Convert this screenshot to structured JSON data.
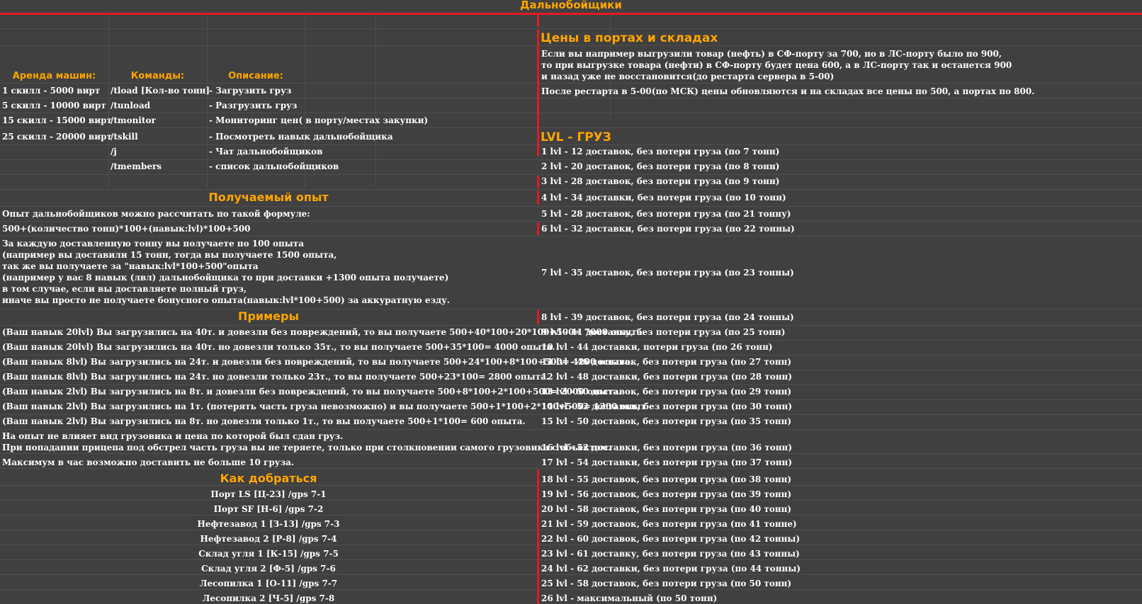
{
  "title": "Дальнобойщики",
  "left": {
    "rent_header": "Аренда машин:",
    "commands_header": "Команды:",
    "description_header": "Описание:",
    "rows": [
      {
        "rent": "1 скилл - 5000 вирт",
        "cmd": "/tload [Кол-во тонн]",
        "desc": "- Загрузить груз"
      },
      {
        "rent": "5 скилл - 10000 вирт",
        "cmd": "/tunload",
        "desc": "- Разгрузить груз"
      },
      {
        "rent": "15 скилл - 15000 вирт",
        "cmd": "/tmonitor",
        "desc": "- Мониторинг цен( в порту/местах закупки)"
      },
      {
        "rent": "25 скилл - 20000 вирт",
        "cmd": "/tskill",
        "desc": "- Посмотреть навык дальнобойщика"
      },
      {
        "rent": "",
        "cmd": "/j",
        "desc": "- Чат дальнобойщиков"
      },
      {
        "rent": "",
        "cmd": "/tmembers",
        "desc": "- список дальнобойщиков"
      }
    ],
    "exp_header": "Получаемый опыт",
    "exp_formula_intro": "Опыт дальнобойщиков можно рассчитать по такой формуле:",
    "exp_formula": "500+(количество тонн)*100+(навык:lvl)*100+500",
    "exp_explanation": [
      "За каждую доставленную тонну вы получаете по 100 опыта",
      "(например вы доставили 15 тонн, тогда вы получаете 1500 опыта,",
      "так же вы получаете за \"навык:lvl*100+500\"опыта",
      "(например у вас 8 навык (лвл) дальнобойщика то при доставки +1300 опыта получаете)",
      "в том случае, если вы доставляете полный груз,",
      "иначе вы просто не получаете бонусного опыта(навык:lvl*100+500) за аккуратную езду."
    ],
    "examples_header": "Примеры",
    "examples": [
      "(Ваш навык 20lvl) Вы загрузились на 40т. и довезли без повреждений, то вы получаете 500+40*100+20*100+500= 7000 опыта.",
      "(Ваш навык 20lvl) Вы загрузились на 40т. но довезли только 35т., то вы получаете 500+35*100= 4000 опыта.",
      "(Ваш навык 8lvl) Вы загрузились на 24т. и довезли без повреждений, то вы получаете 500+24*100+8*100+500= 4200 опыта.",
      "(Ваш навык 8lvl) Вы загрузились на 24т. но довезли только 23т., то вы получаете 500+23*100= 2800 опыта.",
      "(Ваш навык 2lvl) Вы загрузились на 8т. и довезли без повреждений, то вы получаете 500+8*100+2*100+500= 2000 опыта.",
      "(Ваш навык 2lvl) Вы загрузились на 1т. (потерять часть груза невозможно) и вы получаете 500+1*100+2*100+500= 1300 опыт",
      "(Ваш навык 2lvl) Вы загрузились на 8т. но довезли только 1т., то вы получаете 500+1*100= 600 опыта."
    ],
    "notes": [
      "На опыт не влияет вид грузовика и цена по которой был сдан груз.",
      "При попадании прицепа под обстрел часть груза вы не теряете, только при столкновении самого грузовика с объектом."
    ],
    "max_note": "Максимум в час возможно доставить не больше 10 груза.",
    "route_header": "Как добраться",
    "routes": [
      "Порт LS [Ц-23] /gps 7-1",
      "Порт SF [Н-6] /gps 7-2",
      "Нефтезавод 1 [З-13] /gps 7-3",
      "Нефтезавод 2 [Р-8] /gps 7-4",
      "Склад угля 1 [К-15] /gps 7-5",
      "Склад угля 2 [Ф-5] /gps 7-6",
      "Лесопилка 1 [О-11] /gps 7-7",
      "Лесопилка 2 [Ч-5] /gps 7-8"
    ]
  },
  "right": {
    "prices_header": "Цены в портах и складах",
    "prices_text": [
      "Если вы например выгрузили товар (нефть) в СФ-порту за 700, но в ЛС-порту было по 900,",
      "то при выгрузке товара (нефти) в СФ-порту будет цена 600, а в ЛС-порту так и останется 900",
      "и назад уже не восстановится(до рестарта сервера в 5-00)"
    ],
    "restart_text": "После рестарта в 5-00(по МСК) цены обновляются и на складах все цены по 500, а портах по 800.",
    "lvl_header": "LVL - ГРУЗ",
    "levels": [
      "1 lvl - 12 доставок, без потери груза (по 7 тонн)",
      "2 lvl - 20 доставок, без потери груза (по 8 тонн)",
      "3 lvl - 28 доставок, без потери груза (по 9 тонн)",
      "4 lvl - 34 доставки, без потери груза (по 10 тонн)",
      "5 lvl - 28 доставок, без потери груза (по 21 тонну)",
      "6 lvl - 32 доставки, без потери груза (по 22 тонны)",
      "7 lvl - 35 доставок, без потери груза (по 23 тонны)",
      "8 lvl - 39 доставок, без потери груза (по 24 тонны)",
      "9 lvl - 41 доставку, без потери груза (по 25 тонн)",
      "10 lvl - 44 доставки, потери груза (по 26 тонн)",
      "11 lvl - 46 доставок, без потери груза (по 27 тонн)",
      "12 lvl - 48 доставки, без потери груза (по 28 тонн)",
      "13 lvl - 50 доставок, без потери груза (по 29 тонн)",
      "14 lvl - 52 доставки, без потери груза (по 30 тонн)",
      "15 lvl - 50 доставок, без потери груза (по 35 тонн)",
      "16 lvl - 52 доставки, без потери груза (по 36 тонн)",
      "17 lvl - 54 доставки, без потери груза (по 37 тонн)",
      "18 lvl - 55 доставок, без потери груза (по 38 тонн)",
      "19 lvl - 56 доставок, без потери груза (по 39 тонн)",
      "20 lvl - 58 доставок, без потери груза (по 40 тонн)",
      "21 lvl - 59 доставок, без потери груза (по 41 тонне)",
      "22 lvl - 60 доставок, без потери груза (по 42 тонны)",
      "23 lvl - 61 доставку, без потери груза (по 43 тонны)",
      "24 lvl - 62 доставки, без потери груза (по 44 тонны)",
      "25 lvl - 58 доставок, без потери груза (по 50 тонн)",
      "26 lvl - максимальный (по 50 тонн)"
    ]
  }
}
